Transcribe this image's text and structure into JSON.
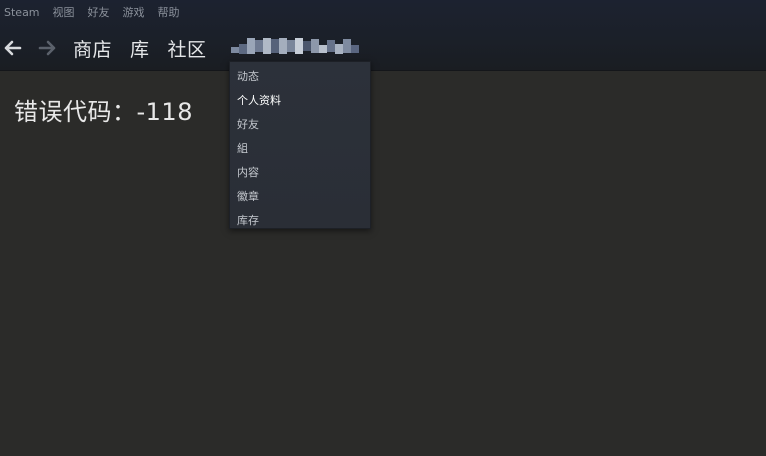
{
  "menubar": {
    "items": [
      "Steam",
      "视图",
      "好友",
      "游戏",
      "帮助"
    ]
  },
  "nav": {
    "back_icon": "arrow-left-icon",
    "forward_icon": "arrow-right-icon",
    "links": [
      "商店",
      "库",
      "社区"
    ]
  },
  "main": {
    "error_text": "错误代码：-118"
  },
  "dropdown": {
    "items": [
      "动态",
      "个人资料",
      "好友",
      "組",
      "内容",
      "徽章",
      "库存"
    ],
    "highlighted_item": "个人资料"
  },
  "colors": {
    "background": "#2b2b29",
    "header": "#1b2029",
    "dropdown": "#2c313a"
  }
}
